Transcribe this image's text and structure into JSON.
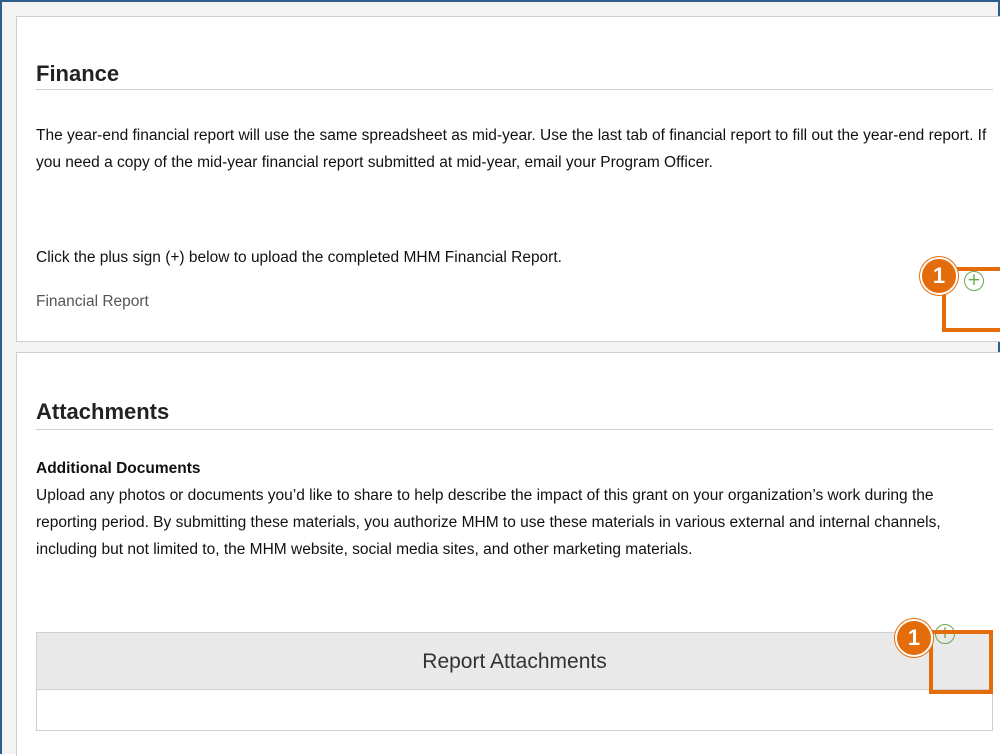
{
  "finance": {
    "title": "Finance",
    "paragraph": "The year-end financial report will use the same spreadsheet as mid-year. Use the last tab of financial report to fill out the year-end report. If you need a copy of the mid-year financial report submitted at mid-year, email your Program Officer.",
    "upload_instruction": "Click the plus sign (+) below to upload the completed MHM Financial Report.",
    "field_label": "Financial Report",
    "add_icon_glyph": "+"
  },
  "attachments": {
    "title": "Attachments",
    "subheading": "Additional Documents",
    "paragraph": "Upload any photos or documents you’d like to share to help describe the impact of this grant on your organization’s work during the reporting period. By submitting these materials, you authorize MHM to use these materials in various external and internal channels, including but not limited to, the MHM website, social media sites, and other marketing materials.",
    "table_header": "Report Attachments",
    "add_icon_glyph": "+"
  },
  "callouts": [
    {
      "number": "1",
      "target": "financial-report-add"
    },
    {
      "number": "1",
      "target": "report-attachments-add"
    }
  ],
  "colors": {
    "accent_orange": "#e46c0a",
    "plus_green": "#6aa84f",
    "frame_blue": "#2e5e8c"
  },
  "icons": {
    "add": "plus-circle-icon"
  }
}
